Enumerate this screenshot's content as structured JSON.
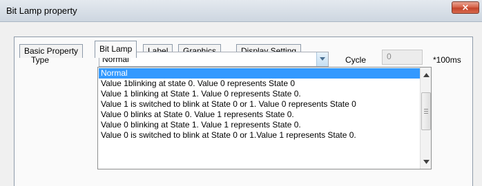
{
  "window": {
    "title": "Bit Lamp property",
    "close_icon": "×"
  },
  "tabs": [
    {
      "label": "Basic Property",
      "active": false
    },
    {
      "label": "Bit Lamp",
      "active": true
    },
    {
      "label": "Label",
      "active": false
    },
    {
      "label": "Graphics",
      "active": false
    },
    {
      "label": "Display Setting",
      "active": false
    }
  ],
  "form": {
    "type_label": "Type",
    "type_value": "Normal",
    "cycle_label": "Cycle",
    "cycle_value": "0",
    "cycle_unit": "*100ms"
  },
  "dropdown": {
    "options": [
      "Normal",
      "Value 1blinking at state 0. Value 0 represents State 0",
      "Value 1 blinking at State 1. Value 0 represents State 0.",
      "Value 1 is switched to blink at State 0 or 1. Value 0 represents State 0",
      "Value 0 blinks at State 0. Value 1 represents State 0.",
      "Value 0 blinking at State 1. Value 1 represents State 0.",
      "Value 0 is switched to blink at State 0 or 1.Value 1 represents State 0."
    ],
    "selected_index": 0
  },
  "colors": {
    "selection": "#3399ff",
    "close_button": "#c3442b",
    "tab_border": "#8d9aa9"
  }
}
